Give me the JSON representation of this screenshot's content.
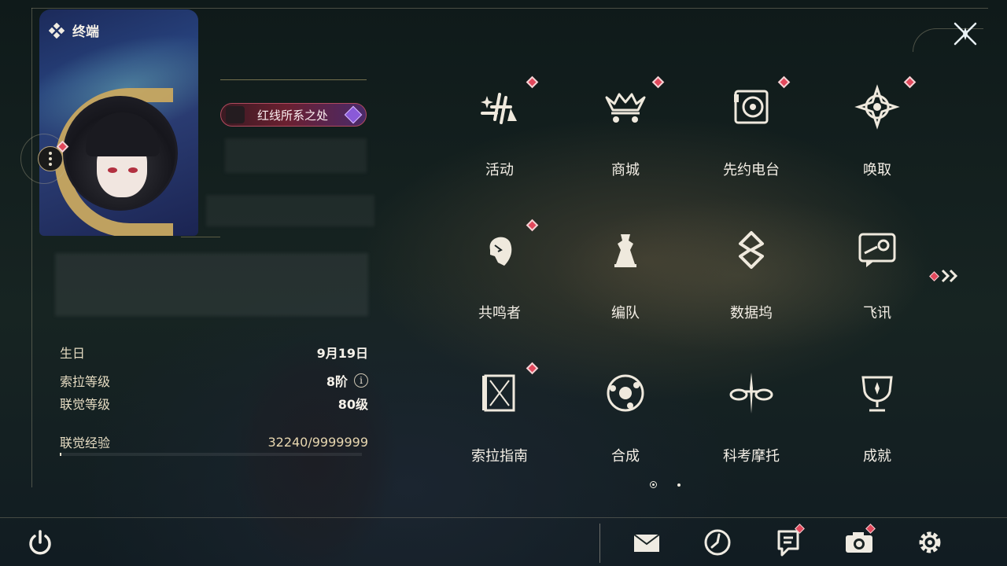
{
  "header": {
    "title": "终端"
  },
  "profile": {
    "title_banner": "红线所系之处"
  },
  "stats": {
    "birthday_label": "生日",
    "birthday_value": "9月19日",
    "sola_level_label": "索拉等级",
    "sola_level_value": "8阶",
    "sola_info": "i",
    "union_level_label": "联觉等级",
    "union_level_value": "80级",
    "union_exp_label": "联觉经验",
    "union_exp_value": "32240/9999999",
    "union_exp_fraction": 0.0032
  },
  "menu": [
    {
      "label": "活动",
      "icon": "activity-icon",
      "badge": true
    },
    {
      "label": "商城",
      "icon": "shop-icon",
      "badge": true
    },
    {
      "label": "先约电台",
      "icon": "radio-icon",
      "badge": true
    },
    {
      "label": "唤取",
      "icon": "convene-icon",
      "badge": true
    },
    {
      "label": "共鸣者",
      "icon": "resonator-icon",
      "badge": true
    },
    {
      "label": "编队",
      "icon": "team-icon",
      "badge": false
    },
    {
      "label": "数据坞",
      "icon": "data-bank-icon",
      "badge": false
    },
    {
      "label": "飞讯",
      "icon": "messages-icon",
      "badge": false
    },
    {
      "label": "索拉指南",
      "icon": "guidebook-icon",
      "badge": true
    },
    {
      "label": "合成",
      "icon": "synthesis-icon",
      "badge": false
    },
    {
      "label": "科考摩托",
      "icon": "motorcycle-icon",
      "badge": false
    },
    {
      "label": "成就",
      "icon": "achievement-icon",
      "badge": false
    }
  ],
  "pager": {
    "current_page": 1,
    "total_pages": 2
  },
  "bottom_bar": [
    {
      "icon": "mail-icon",
      "badge": false
    },
    {
      "icon": "clock-icon",
      "badge": false
    },
    {
      "icon": "notice-icon",
      "badge": true
    },
    {
      "icon": "camera-icon",
      "badge": true
    },
    {
      "icon": "settings-icon",
      "badge": false
    }
  ],
  "colors": {
    "accent_gold": "#c9a860",
    "badge_red": "#e2485c",
    "text": "#f4efe6"
  }
}
